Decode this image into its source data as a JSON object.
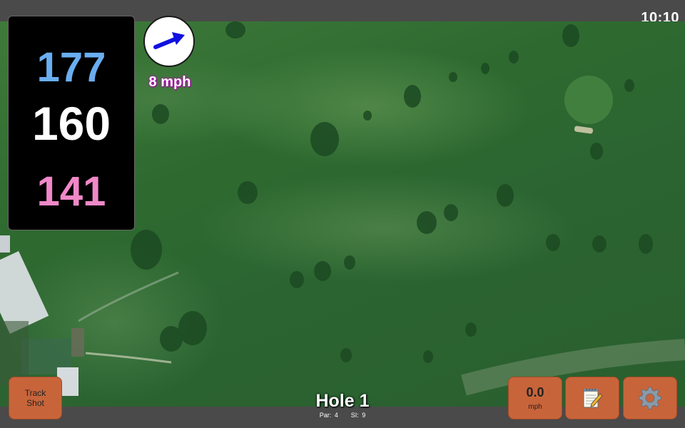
{
  "status_bar": {
    "time": "10:10"
  },
  "yardage": {
    "back": "177",
    "middle": "160",
    "front": "141"
  },
  "wind": {
    "speed": "8 mph",
    "icon": "wind-direction-arrow-icon"
  },
  "hole": {
    "title": "Hole 1",
    "par_label": "Par:",
    "par": "4",
    "si_label": "SI:",
    "si": "9"
  },
  "buttons": {
    "track_shot_line1": "Track",
    "track_shot_line2": "Shot",
    "speed_value": "0.0",
    "speed_unit": "mph",
    "notes_icon": "notepad-icon",
    "settings_icon": "gear-icon"
  },
  "colors": {
    "back_yardage": "#6aaef0",
    "middle_yardage": "#ffffff",
    "front_yardage": "#f088c8",
    "button": "#c8643a",
    "wind_arrow": "#1010e0"
  }
}
